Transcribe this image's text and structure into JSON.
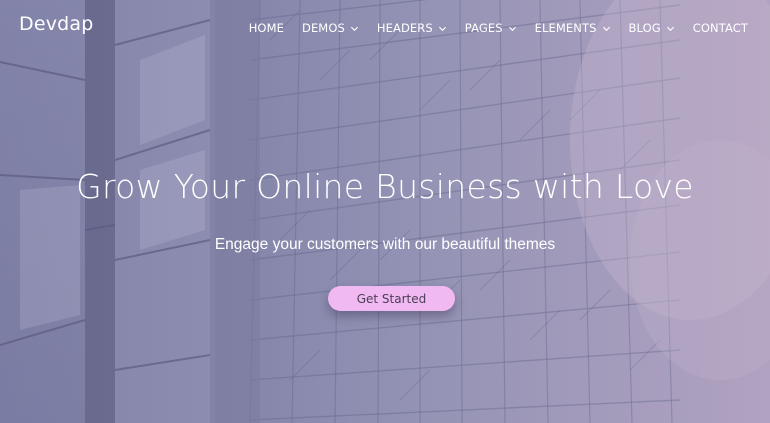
{
  "navbar": {
    "brand": "Devdap",
    "items": [
      {
        "label": "HOME",
        "has_dropdown": false
      },
      {
        "label": "DEMOS",
        "has_dropdown": true
      },
      {
        "label": "HEADERS",
        "has_dropdown": true
      },
      {
        "label": "PAGES",
        "has_dropdown": true
      },
      {
        "label": "ELEMENTS",
        "has_dropdown": true
      },
      {
        "label": "BLOG",
        "has_dropdown": true
      },
      {
        "label": "CONTACT",
        "has_dropdown": false
      }
    ]
  },
  "hero": {
    "headline": "Grow Your Online Business with Love",
    "subheadline": "Engage your customers with our beautiful themes",
    "cta_label": "Get Started"
  },
  "colors": {
    "overlay_tint": "#8d86a6",
    "cta_background": "#f1b9f2",
    "cta_text": "#4a3f55",
    "nav_text": "#ffffff"
  },
  "icons": {
    "dropdown": "chevron-down-icon"
  }
}
